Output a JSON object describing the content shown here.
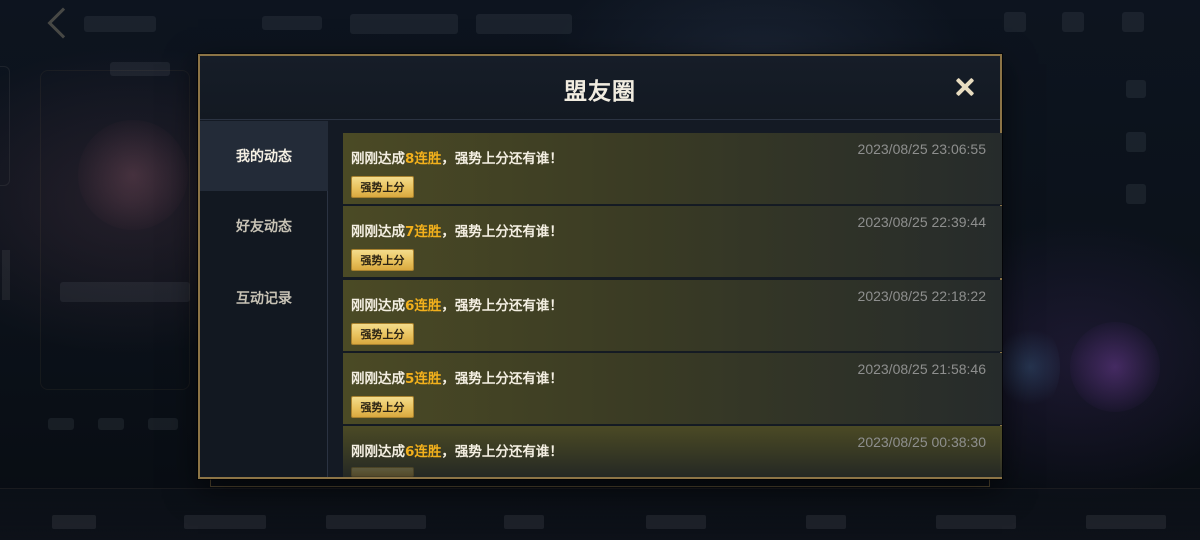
{
  "modal": {
    "title": "盟友圈",
    "close_icon": "close-icon"
  },
  "sidebar": {
    "tabs": [
      {
        "label": "我的动态",
        "active": true
      },
      {
        "label": "好友动态",
        "active": false
      },
      {
        "label": "互动记录",
        "active": false
      }
    ]
  },
  "feed": {
    "items": [
      {
        "prefix": "刚刚达成",
        "highlight": "8连胜",
        "suffix": "，强势上分还有谁！",
        "timestamp": "2023/08/25 23:06:55",
        "tag": "强势上分"
      },
      {
        "prefix": "刚刚达成",
        "highlight": "7连胜",
        "suffix": "，强势上分还有谁！",
        "timestamp": "2023/08/25 22:39:44",
        "tag": "强势上分"
      },
      {
        "prefix": "刚刚达成",
        "highlight": "6连胜",
        "suffix": "，强势上分还有谁！",
        "timestamp": "2023/08/25 22:18:22",
        "tag": "强势上分"
      },
      {
        "prefix": "刚刚达成",
        "highlight": "5连胜",
        "suffix": "，强势上分还有谁！",
        "timestamp": "2023/08/25 21:58:46",
        "tag": "强势上分"
      },
      {
        "prefix": "刚刚达成",
        "highlight": "6连胜",
        "suffix": "，强势上分还有谁！",
        "timestamp": "2023/08/25 00:38:30",
        "tag": ""
      }
    ]
  },
  "colors": {
    "accent_gold": "#f2b01c",
    "border_gold": "#8c7446",
    "panel_bg": "#141a24"
  }
}
